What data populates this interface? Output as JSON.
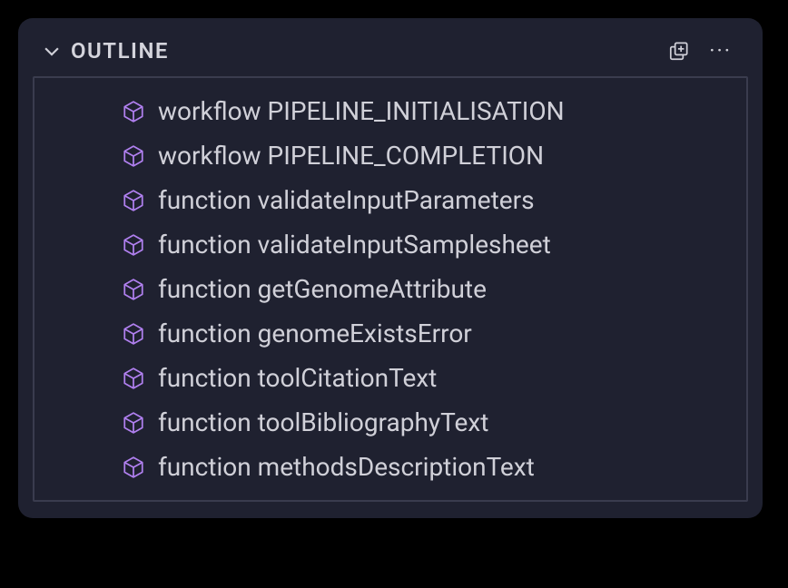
{
  "outline": {
    "title": "OUTLINE",
    "items": [
      {
        "label": "workflow PIPELINE_INITIALISATION"
      },
      {
        "label": "workflow PIPELINE_COMPLETION"
      },
      {
        "label": "function validateInputParameters"
      },
      {
        "label": "function validateInputSamplesheet"
      },
      {
        "label": "function getGenomeAttribute"
      },
      {
        "label": "function genomeExistsError"
      },
      {
        "label": "function toolCitationText"
      },
      {
        "label": "function toolBibliographyText"
      },
      {
        "label": "function methodsDescriptionText"
      }
    ]
  }
}
